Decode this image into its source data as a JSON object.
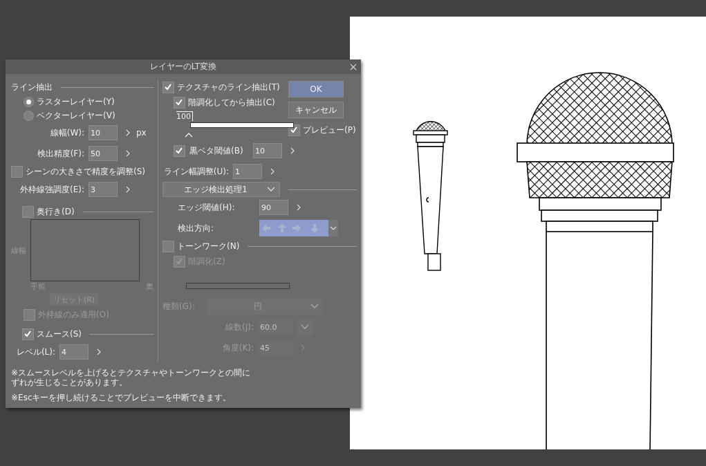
{
  "dialog": {
    "title": "レイヤーのLT変換"
  },
  "line_extraction": {
    "heading": "ライン抽出",
    "layer_types": [
      {
        "label": "ラスターレイヤー(Y)",
        "selected": true
      },
      {
        "label": "ベクターレイヤー(V)",
        "selected": false
      }
    ],
    "fields": [
      {
        "label": "線幅(W):",
        "value": "10",
        "unit": "px"
      },
      {
        "label": "検出精度(F):",
        "value": "50"
      }
    ],
    "scene_adjust": {
      "label": "シーンの大きさで精度を調整(S)",
      "checked": false
    },
    "outline_strength": {
      "label": "外枠線強調度(E):",
      "value": "3"
    }
  },
  "depth": {
    "label": "奥行き(D)",
    "checked": false,
    "axis_label": "線幅",
    "near_label": "手前",
    "far_label": "奥",
    "reset_button": "リセット(R)",
    "outline_only": {
      "label": "外枠線のみ適用(O)",
      "checked": false
    }
  },
  "smooth": {
    "label": "スムース(S)",
    "checked": true,
    "level_label": "レベル(L):",
    "level_value": "4"
  },
  "texture": {
    "label": "テクスチャのライン抽出(T)",
    "checked": true,
    "posterize": {
      "label": "階調化してから抽出(C)",
      "checked": true
    },
    "threshold_marker": "100",
    "black_fill": {
      "label": "黒ベタ閾値(B)",
      "checked": true,
      "value": "10"
    },
    "line_width_adjust": {
      "label": "ライン幅調整(U):",
      "value": "1"
    },
    "edge_mode": "エッジ検出処理1",
    "edge_threshold": {
      "label": "エッジ閾値(H):",
      "value": "90"
    },
    "direction_label": "検出方向:"
  },
  "tone_work": {
    "label": "トーンワーク(N)",
    "checked": false,
    "posterize": {
      "label": "階調化(Z)",
      "checked": true
    },
    "type": {
      "label": "種類(G):",
      "value": "円"
    },
    "lines": {
      "label": "線数(J):",
      "value": "60.0"
    },
    "angle": {
      "label": "角度(K):",
      "value": "45"
    }
  },
  "buttons": {
    "ok": "OK",
    "cancel": "キャンセル"
  },
  "preview": {
    "label": "プレビュー(P)",
    "checked": true
  },
  "notes": [
    {
      "lines": [
        "※スムースレベルを上げるとテクスチャやトーンワークとの間に",
        "ずれが生じることがあります。"
      ]
    },
    {
      "lines": [
        "※Escキーを押し続けることでプレビューを中断できます。"
      ]
    }
  ]
}
